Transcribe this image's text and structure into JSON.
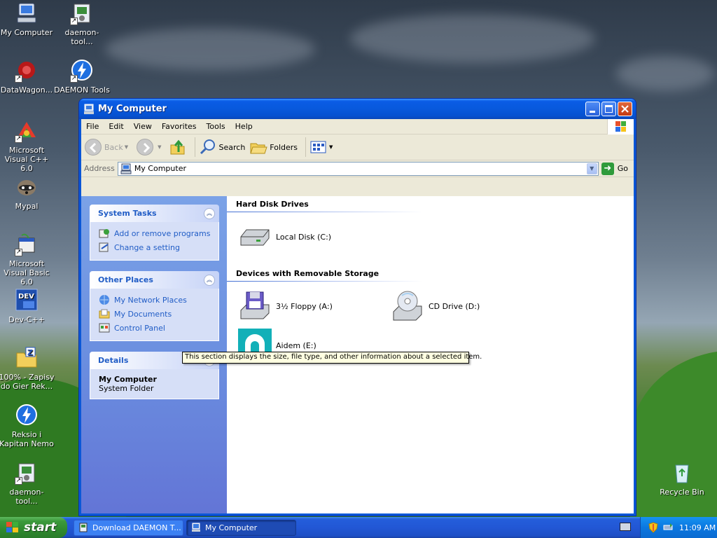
{
  "desktop": {
    "icons": [
      {
        "label": "My Computer",
        "icon": "computer-icon"
      },
      {
        "label": "daemon-tool...",
        "icon": "installer-icon"
      },
      {
        "label": "DataWagon...",
        "icon": "datawagon-icon"
      },
      {
        "label": "DAEMON Tools",
        "icon": "lightning-icon"
      },
      {
        "label": "Microsoft Visual C++ 6.0",
        "icon": "visual-cpp-icon"
      },
      {
        "label": "Mypal",
        "icon": "raccoon-icon"
      },
      {
        "label": "Microsoft Visual Basic 6.0",
        "icon": "visual-basic-icon"
      },
      {
        "label": "Dev-C++",
        "icon": "devcpp-icon"
      },
      {
        "label": "100% - Zapisy do Gier Rek...",
        "icon": "zip-folder-icon"
      },
      {
        "label": "Reksio i Kapitan Nemo",
        "icon": "lightning-icon"
      },
      {
        "label": "daemon-tool...",
        "icon": "installer-icon"
      },
      {
        "label": "Recycle Bin",
        "icon": "recycle-bin-icon"
      }
    ]
  },
  "window": {
    "title": "My Computer",
    "menu": [
      "File",
      "Edit",
      "View",
      "Favorites",
      "Tools",
      "Help"
    ],
    "toolbar": {
      "back": "Back",
      "search": "Search",
      "folders": "Folders"
    },
    "address": {
      "label": "Address",
      "value": "My Computer",
      "go": "Go"
    },
    "taskpane": {
      "system_tasks": {
        "title": "System Tasks",
        "items": [
          "Add or remove programs",
          "Change a setting"
        ]
      },
      "other_places": {
        "title": "Other Places",
        "items": [
          "My Network Places",
          "My Documents",
          "Control Panel"
        ]
      },
      "details": {
        "title": "Details",
        "name": "My Computer",
        "type": "System Folder"
      }
    },
    "groups": {
      "hard_disks": {
        "title": "Hard Disk Drives",
        "items": [
          "Local Disk (C:)"
        ]
      },
      "removable": {
        "title": "Devices with Removable Storage",
        "items": [
          "3½ Floppy (A:)",
          "CD Drive (D:)",
          "Aidem (E:)"
        ]
      }
    },
    "tooltip": "This section displays the size, file type, and other information about a selected item."
  },
  "taskbar": {
    "start": "start",
    "tasks": [
      "Download DAEMON T...",
      "My Computer"
    ],
    "clock": "11:09 AM"
  }
}
